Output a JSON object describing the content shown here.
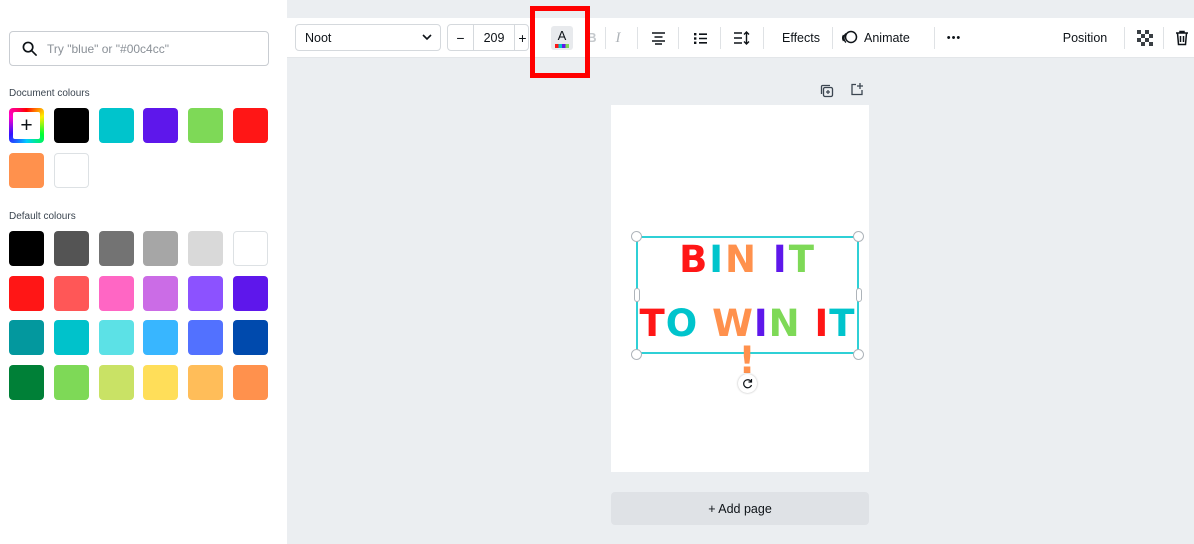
{
  "search": {
    "placeholder": "Try \"blue\" or \"#00c4cc\""
  },
  "document_colours": {
    "label": "Document colours",
    "swatches": [
      "#000000",
      "#00c4cc",
      "#5e17eb",
      "#7ed957",
      "#ff1616",
      "#ff914d",
      "#ffffff"
    ]
  },
  "default_colours": {
    "label": "Default colours",
    "swatches": [
      "#000000",
      "#545454",
      "#737373",
      "#a6a6a6",
      "#d9d9d9",
      "#ffffff",
      "#ff1616",
      "#ff5757",
      "#ff66c4",
      "#cb6ce6",
      "#8c52ff",
      "#5e17eb",
      "#03989e",
      "#00c2cb",
      "#5ce1e6",
      "#38b6ff",
      "#5271ff",
      "#004aad",
      "#008037",
      "#7ed957",
      "#c9e265",
      "#ffde59",
      "#ffbd59",
      "#ff914d"
    ]
  },
  "toolbar": {
    "font": "Noot",
    "size_minus": "−",
    "font_size": "209",
    "size_plus": "+",
    "color_letter": "A",
    "bold": "B",
    "italic": "I",
    "effects": "Effects",
    "animate": "Animate",
    "more": "•••",
    "position": "Position"
  },
  "canvas": {
    "line1": [
      {
        "ch": "B",
        "color": "#ff1616"
      },
      {
        "ch": "I",
        "color": "#00c4cc"
      },
      {
        "ch": "N",
        "color": "#ff914d"
      },
      {
        "ch": " ",
        "color": "#000000"
      },
      {
        "ch": "I",
        "color": "#5e17eb"
      },
      {
        "ch": "T",
        "color": "#7ed957"
      }
    ],
    "line2": [
      {
        "ch": "T",
        "color": "#ff1616"
      },
      {
        "ch": "O",
        "color": "#00c4cc"
      },
      {
        "ch": " ",
        "color": "#000000"
      },
      {
        "ch": "W",
        "color": "#ff914d"
      },
      {
        "ch": "I",
        "color": "#5e17eb"
      },
      {
        "ch": "N",
        "color": "#7ed957"
      },
      {
        "ch": " ",
        "color": "#000000"
      },
      {
        "ch": "I",
        "color": "#ff1616"
      },
      {
        "ch": "T",
        "color": "#00c4cc"
      },
      {
        "ch": "!",
        "color": "#ff914d"
      }
    ],
    "add_page": "+ Add page"
  },
  "accent_colors": {
    "selection": "#2fd0d6",
    "highlight_box": "#ff0000"
  }
}
